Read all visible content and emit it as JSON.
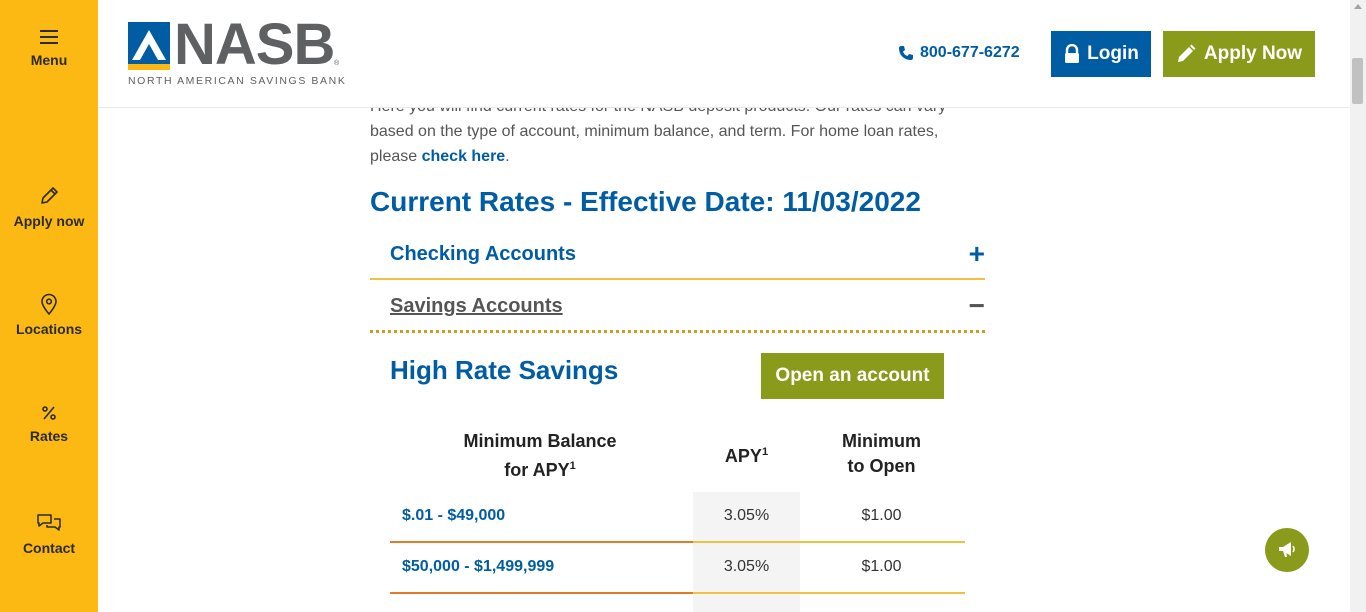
{
  "sidebar": {
    "items": [
      {
        "label": "Menu",
        "icon": "hamburger-icon"
      },
      {
        "label": "Apply now",
        "icon": "pencil-icon"
      },
      {
        "label": "Locations",
        "icon": "map-pin-icon"
      },
      {
        "label": "Rates",
        "icon": "percent-icon"
      },
      {
        "label": "Contact",
        "icon": "chat-bubbles-icon"
      }
    ]
  },
  "header": {
    "logo_word": "NASB",
    "logo_reg": "®",
    "logo_tagline": "NORTH AMERICAN SAVINGS BANK",
    "phone": "800-677-6272",
    "login_label": "Login",
    "apply_label": "Apply Now"
  },
  "intro": {
    "line1": "Here you will find current rates for the NASB deposit products. Our rates can vary",
    "line2": "based on the type of account, minimum balance, and term. For home loan rates,",
    "line3_prefix": "please ",
    "link": "check here",
    "line3_suffix": "."
  },
  "rates_title": "Current Rates - Effective Date: 11/03/2022",
  "accordion": [
    {
      "label": "Checking Accounts",
      "icon_symbol": "+",
      "expanded": false
    },
    {
      "label": "Savings Accounts",
      "icon_symbol": "−",
      "expanded": true
    }
  ],
  "savings": {
    "title": "High Rate Savings",
    "open_label": "Open an account",
    "headers": {
      "min_balance_line1": "Minimum Balance",
      "min_balance_line2": "for APY",
      "apy": "APY",
      "sup": "1",
      "min_open_line1": "Minimum",
      "min_open_line2": "to Open"
    },
    "rows": [
      {
        "balance": "$.01 - $49,000",
        "apy": "3.05%",
        "min_open": "$1.00"
      },
      {
        "balance": "$50,000 - $1,499,999",
        "apy": "3.05%",
        "min_open": "$1.00"
      }
    ]
  },
  "colors": {
    "brand_blue": "#005da3",
    "brand_yellow": "#fdb913",
    "brand_green": "#8a9a1b"
  }
}
